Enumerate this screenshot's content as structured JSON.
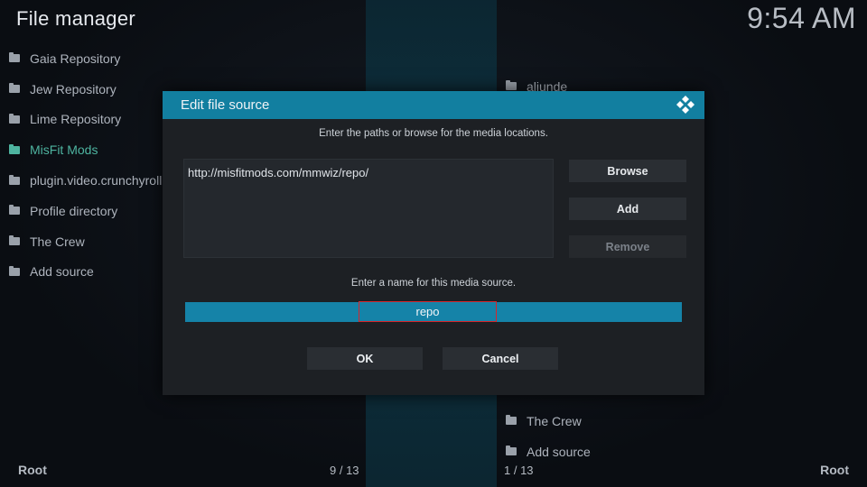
{
  "app": {
    "title": "File manager",
    "clock": "9:54 AM"
  },
  "left_panel": {
    "items": [
      {
        "label": "Gaia Repository"
      },
      {
        "label": "Jew Repository"
      },
      {
        "label": "Lime Repository"
      },
      {
        "label": "MisFit Mods"
      },
      {
        "label": "plugin.video.crunchyroll"
      },
      {
        "label": "Profile directory"
      },
      {
        "label": "The Crew"
      },
      {
        "label": "Add source"
      }
    ],
    "active_index": 3,
    "footer_label": "Root",
    "count": "9 / 13"
  },
  "right_panel": {
    "top_items": [
      {
        "label": "aliunde"
      }
    ],
    "bottom_items": [
      {
        "label": "The Crew"
      },
      {
        "label": "Add source"
      }
    ],
    "footer_label": "Root",
    "count": "1 / 13"
  },
  "dialog": {
    "title": "Edit file source",
    "paths_instruction": "Enter the paths or browse for the media locations.",
    "paths": [
      "http://misfitmods.com/mmwiz/repo/"
    ],
    "browse_label": "Browse",
    "add_label": "Add",
    "remove_label": "Remove",
    "name_instruction": "Enter a name for this media source.",
    "name_value": "repo",
    "ok_label": "OK",
    "cancel_label": "Cancel"
  },
  "colors": {
    "accent": "#127fa0",
    "highlight_bar": "#1583a8",
    "active_item": "#4eb4a0",
    "focus_border": "#d6262c"
  }
}
